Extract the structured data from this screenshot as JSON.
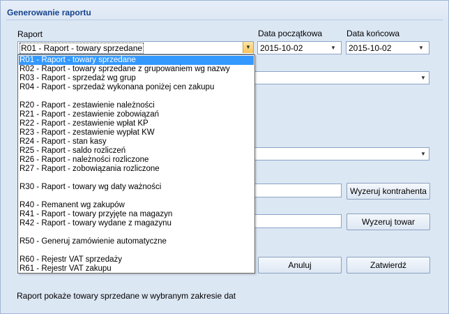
{
  "panel": {
    "title": "Generowanie raportu"
  },
  "labels": {
    "raport": "Raport",
    "data_poczatkowa": "Data początkowa",
    "data_koncowa": "Data końcowa"
  },
  "report_combo": {
    "value": "R01 - Raport - towary sprzedane"
  },
  "date_start": {
    "value": "2015-10-02"
  },
  "date_end": {
    "value": "2015-10-02"
  },
  "dropdown": {
    "items": [
      "R01 - Raport - towary sprzedane",
      "R02 - Raport - towary sprzedane z grupowaniem wg nazwy",
      "R03 - Raport - sprzedaż wg grup",
      "R04 - Raport - sprzedaż wykonana poniżej cen zakupu",
      "",
      "R20 - Raport - zestawienie należności",
      "R21 - Raport - zestawienie zobowiązań",
      "R22 - Raport - zestawienie wpłat KP",
      "R23 - Raport - zestawienie wypłat KW",
      "R24 - Raport - stan kasy",
      "R25 - Raport - saldo rozliczeń",
      "R26 - Raport - należności rozliczone",
      "R27 - Raport - zobowiązania rozliczone",
      "",
      "R30 - Raport - towary wg daty ważności",
      "",
      "R40 - Remanent wg zakupów",
      "R41 - Raport - towary przyjęte na magazyn",
      "R42 - Raport - towary wydane z magazynu",
      "",
      "R50 - Generuj zamówienie automatyczne",
      "",
      "R60 - Rejestr VAT sprzedaży",
      "R61 - Rejestr VAT zakupu"
    ]
  },
  "buttons": {
    "wyzeruj_kontrahenta": "Wyzeruj kontrahenta",
    "wyzeruj_towar": "Wyzeruj towar",
    "anuluj": "Anuluj",
    "zatwierdz": "Zatwierdź"
  },
  "footer": {
    "description": "Raport pokaże towary sprzedane w wybranym zakresie dat"
  }
}
